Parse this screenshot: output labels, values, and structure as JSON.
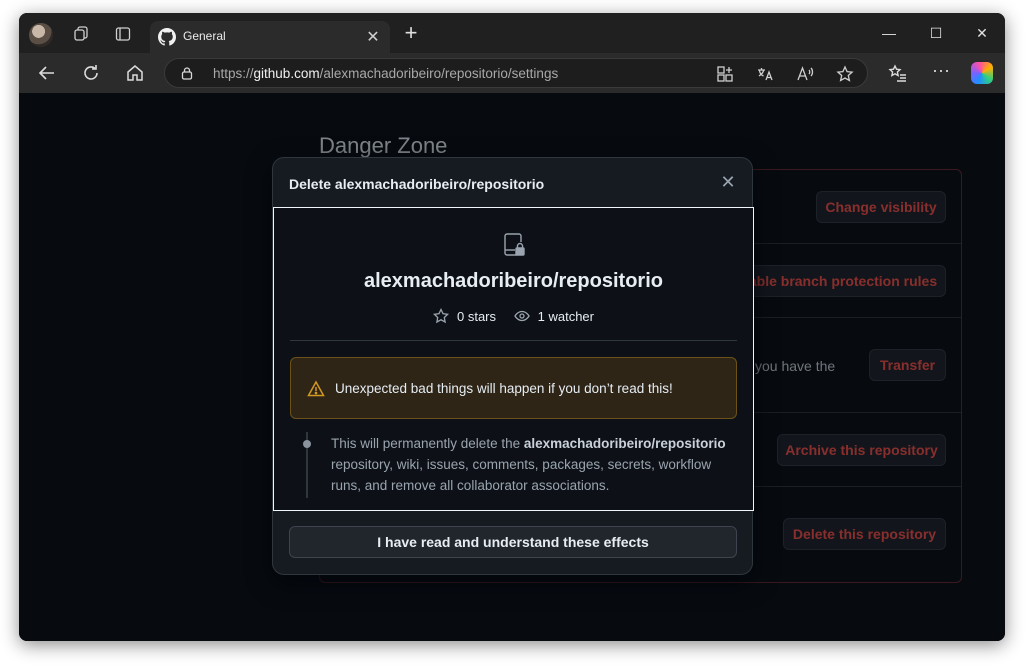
{
  "browser": {
    "tab_title": "General",
    "url_prefix": "https://",
    "url_host": "github.com",
    "url_path": "/alexmachadoribeiro/repositorio/settings"
  },
  "page": {
    "section_title": "Danger Zone",
    "rows": [
      {
        "button": "Change visibility"
      },
      {
        "button": "able branch protection rules"
      },
      {
        "text": "you have the",
        "button": "Transfer"
      },
      {
        "button": "Archive this repository"
      },
      {
        "button": "Delete this repository"
      }
    ]
  },
  "modal": {
    "title": "Delete alexmachadoribeiro/repositorio",
    "repo_name": "alexmachadoribeiro/repositorio",
    "stars": "0 stars",
    "watchers": "1 watcher",
    "warning": "Unexpected bad things will happen if you don’t read this!",
    "effect_prefix": "This will permanently delete the ",
    "effect_repo": "alexmachadoribeiro/repositorio",
    "effect_suffix": " repository, wiki, issues, comments, packages, secrets, workflow runs, and remove all collaborator associations.",
    "confirm_label": "I have read and understand these effects"
  },
  "colors": {
    "danger": "#f85149",
    "warning": "#d29922",
    "page_bg": "#0d1117"
  }
}
